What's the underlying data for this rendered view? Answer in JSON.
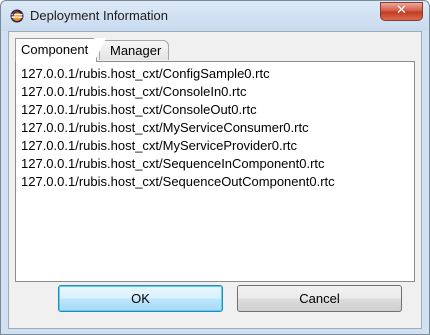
{
  "window": {
    "title": "Deployment Information",
    "close_symbol": "✕"
  },
  "tabs": [
    {
      "label": "Component",
      "active": true
    },
    {
      "label": "Manager",
      "active": false
    }
  ],
  "components": [
    "127.0.0.1/rubis.host_cxt/ConfigSample0.rtc",
    "127.0.0.1/rubis.host_cxt/ConsoleIn0.rtc",
    "127.0.0.1/rubis.host_cxt/ConsoleOut0.rtc",
    "127.0.0.1/rubis.host_cxt/MyServiceConsumer0.rtc",
    "127.0.0.1/rubis.host_cxt/MyServiceProvider0.rtc",
    "127.0.0.1/rubis.host_cxt/SequenceInComponent0.rtc",
    "127.0.0.1/rubis.host_cxt/SequenceOutComponent0.rtc"
  ],
  "buttons": {
    "ok_label": "OK",
    "cancel_label": "Cancel"
  },
  "colors": {
    "window_frame": "#d2e1f1",
    "ok_highlight": "#bee6fd",
    "close_button": "#c13a22"
  },
  "icons": {
    "app_icon": "eclipse-icon",
    "close_icon": "close-icon"
  }
}
